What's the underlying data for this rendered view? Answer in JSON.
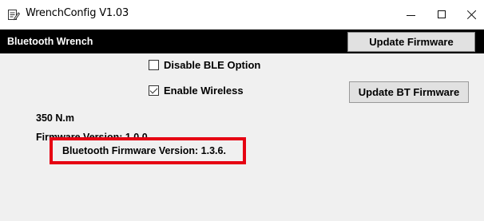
{
  "window": {
    "title": "WrenchConfig V1.03",
    "app_icon": "notepad-edit-icon"
  },
  "title_controls": {
    "minimize": "minimize-icon",
    "maximize": "maximize-icon",
    "close": "close-icon"
  },
  "header": {
    "title": "Bluetooth Wrench",
    "update_firmware_label": "Update Firmware"
  },
  "options": {
    "disable_ble": {
      "label": "Disable BLE Option",
      "checked": false
    },
    "enable_wireless": {
      "label": "Enable Wireless",
      "checked": true
    }
  },
  "update_bt_firmware_label": "Update BT Firmware",
  "info": {
    "torque": "350 N.m",
    "firmware_version": "Firmware Version: 1.0.0",
    "bt_firmware_version": "Bluetooth Firmware Version: 1.3.6."
  },
  "colors": {
    "header_bg": "#000000",
    "highlight": "#e60012",
    "window_bg": "#f0f0f0"
  }
}
